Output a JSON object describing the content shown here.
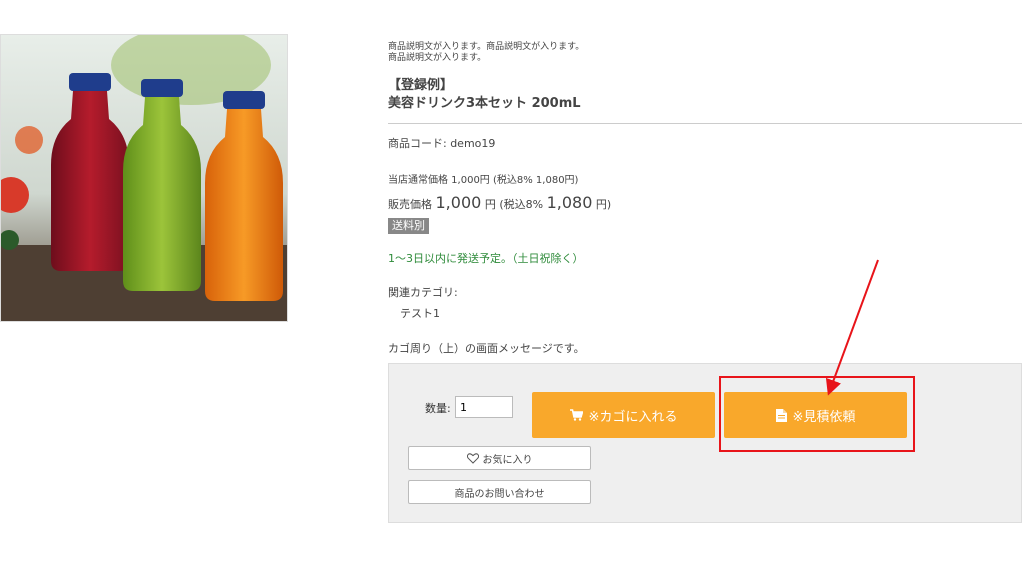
{
  "product": {
    "description_line1": "商品説明文が入ります。商品説明文が入ります。",
    "description_line2": "商品説明文が入ります。",
    "title_tag": "【登録例】",
    "title_name": "美容ドリンク3本セット 200mL",
    "code": "商品コード: demo19",
    "regular_price": "当店通常価格 1,000円 (税込8% 1,080円)",
    "sale_label": "販売価格",
    "sale_price": "1,000",
    "sale_unit": "円",
    "tax_label": "(税込8%",
    "tax_price": "1,080",
    "tax_unit": "円)",
    "shipping_badge": "送料別",
    "delivery": "1〜3日以内に発送予定。（土日祝除く）",
    "category_label": "関連カテゴリ:",
    "category_item": "テスト1",
    "cart_message": "カゴ周り（上）の画面メッセージです。"
  },
  "cart": {
    "qty_label": "数量:",
    "qty_value": "1",
    "add_to_cart": "※カゴに入れる",
    "request_quote": "※見積依頼",
    "favorite": "お気に入り",
    "inquiry": "商品のお問い合わせ"
  },
  "icons": {
    "cart": "cart-icon",
    "document": "document-icon",
    "heart": "heart-icon"
  },
  "colors": {
    "accent": "#f9a82b",
    "highlight": "#e8141a",
    "delivery": "#2e8b3a",
    "badge": "#888888"
  }
}
